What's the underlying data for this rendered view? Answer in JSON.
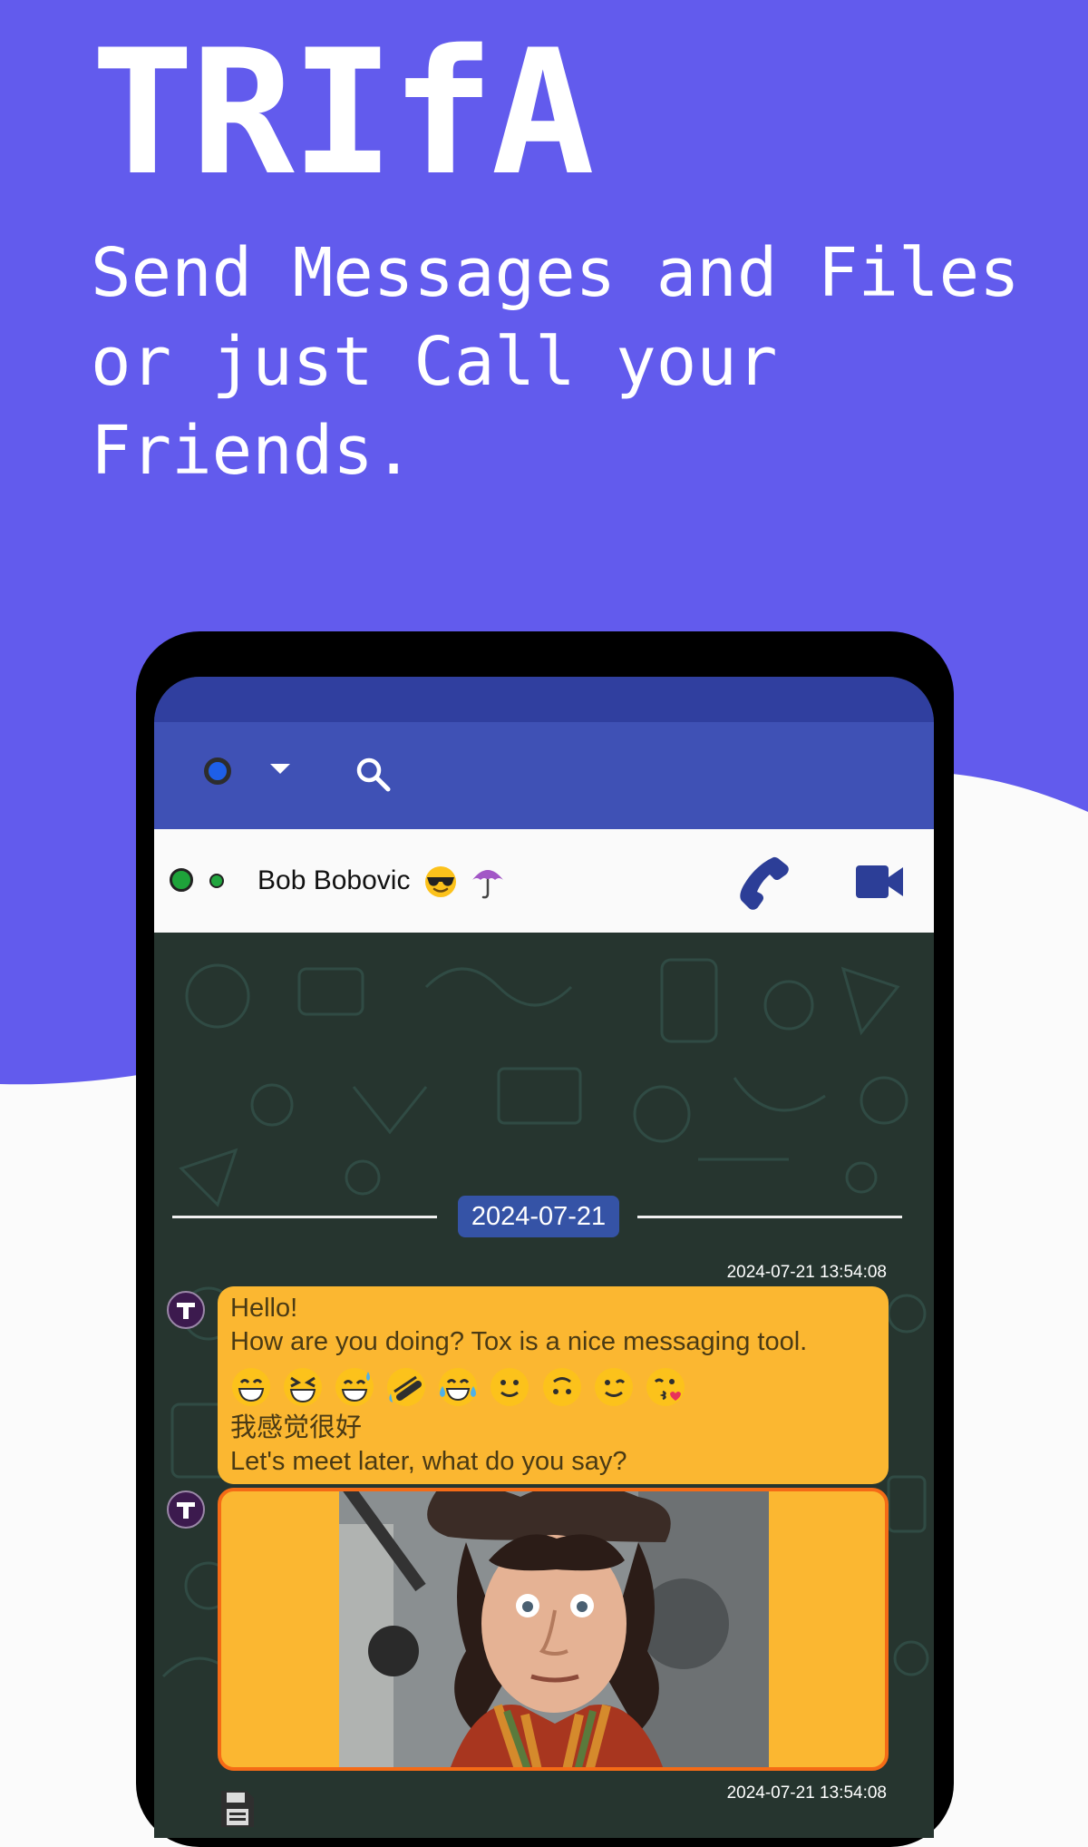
{
  "hero": {
    "bg_color": "#625bed",
    "title": "TRIfA",
    "subtitle": "Send Messages and Files or just Call your Friends."
  },
  "toolbar": {
    "status_color": "#1e5fe8",
    "search_icon": "search-icon",
    "dropdown_icon": "caret-down-icon"
  },
  "contact": {
    "name": "Bob Bobovic",
    "name_emojis": [
      "sunglasses-emoji",
      "umbrella-emoji"
    ],
    "presence_color": "#1ea33a",
    "call_icon": "phone-icon",
    "video_icon": "video-camera-icon",
    "accent_color": "#2c3e97"
  },
  "chat": {
    "date_separator": "2024-07-21",
    "messages": [
      {
        "timestamp": "2024-07-21 13:54:08",
        "line1": "Hello!",
        "line2": "How are you doing? Tox is a nice messaging tool.",
        "emojis": [
          "grinning-smile-eyes",
          "laughing",
          "sweat-smile",
          "rolling-on-floor-laughing",
          "tears-of-joy",
          "slightly-smiling",
          "upside-down",
          "winking",
          "face-blowing-kiss"
        ],
        "line3": "我感觉很好",
        "line4": "Let's meet later, what do you say?"
      },
      {
        "timestamp": "2024-07-21 13:54:08",
        "type": "image",
        "file_icon": "floppy-save-icon"
      }
    ],
    "bubble_color": "#fbb731",
    "image_border_color": "#f56b16"
  }
}
